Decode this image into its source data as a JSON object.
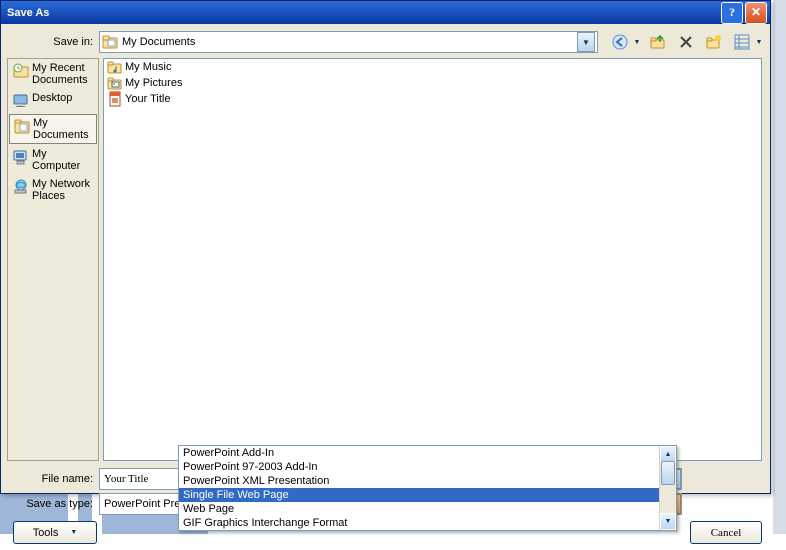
{
  "window": {
    "title": "Save As"
  },
  "labels": {
    "save_in": "Save in:",
    "file_name": "File name:",
    "save_as_type": "Save as type:",
    "tools": "Tools",
    "cancel": "Cancel"
  },
  "save_in": {
    "selected": "My Documents"
  },
  "sidebar": {
    "items": [
      {
        "label": "My Recent Documents"
      },
      {
        "label": "Desktop"
      },
      {
        "label": "My Documents"
      },
      {
        "label": "My Computer"
      },
      {
        "label": "My Network Places"
      }
    ]
  },
  "files": {
    "items": [
      {
        "label": "My Music",
        "kind": "folder"
      },
      {
        "label": "My Pictures",
        "kind": "folder"
      },
      {
        "label": "Your Title",
        "kind": "ppt"
      }
    ]
  },
  "file_name": {
    "value": "Your Title"
  },
  "save_as_type": {
    "value": "PowerPoint Presentation",
    "options": [
      {
        "label": "PowerPoint Add-In"
      },
      {
        "label": "PowerPoint 97-2003 Add-In"
      },
      {
        "label": "PowerPoint XML Presentation"
      },
      {
        "label": "Single File Web Page",
        "selected": true
      },
      {
        "label": "Web Page"
      },
      {
        "label": "GIF Graphics Interchange Format"
      }
    ]
  }
}
